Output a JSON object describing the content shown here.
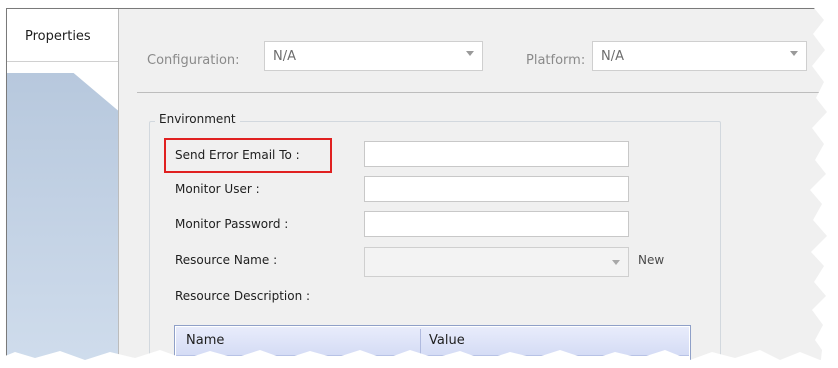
{
  "tabs": {
    "properties": "Properties"
  },
  "config": {
    "configuration_label": "Configuration:",
    "configuration_value": "N/A",
    "platform_label": "Platform:",
    "platform_value": "N/A"
  },
  "environment": {
    "title": "Environment",
    "send_error_email_label": "Send Error Email To :",
    "send_error_email_value": "",
    "monitor_user_label": "Monitor User :",
    "monitor_user_value": "",
    "monitor_password_label": "Monitor Password :",
    "monitor_password_value": "",
    "resource_name_label": "Resource Name :",
    "resource_name_value": "",
    "new_link": "New",
    "resource_description_label": "Resource Description :"
  },
  "table": {
    "columns": [
      "Name",
      "Value"
    ]
  },
  "colors": {
    "highlight": "#e02020",
    "table_header": "#d5dcf5",
    "left_panel": "#b7c8dd"
  }
}
